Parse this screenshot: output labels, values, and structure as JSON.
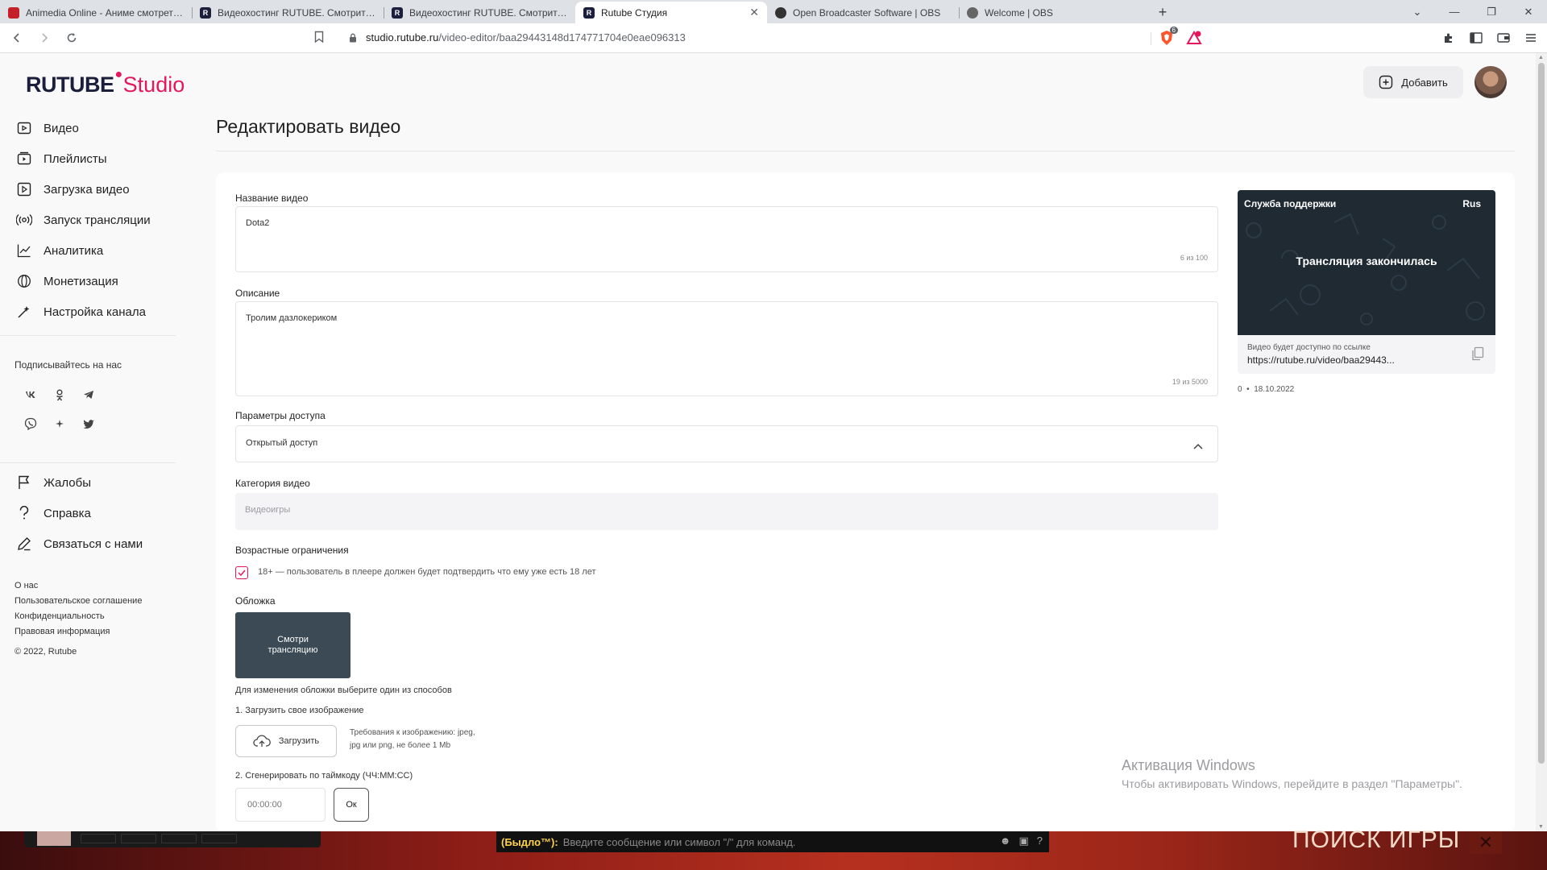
{
  "browser": {
    "tabs": [
      {
        "title": "Animedia Online - Аниме смотреть о",
        "fav_color": "#c3202a",
        "fav_glyph": ""
      },
      {
        "title": "Видеохостинг RUTUBE. Смотрите ви",
        "fav_color": "#1b1f3b",
        "fav_glyph": "R"
      },
      {
        "title": "Видеохостинг RUTUBE. Смотрите ви",
        "fav_color": "#1b1f3b",
        "fav_glyph": "R"
      },
      {
        "title": "Rutube Студия",
        "fav_color": "#1b1f3b",
        "fav_glyph": "R",
        "active": true
      },
      {
        "title": "Open Broadcaster Software | OBS",
        "fav_color": "#333333",
        "fav_glyph": ""
      },
      {
        "title": "Welcome | OBS",
        "fav_color": "#666666",
        "fav_glyph": ""
      }
    ],
    "url_host": "studio.rutube.ru",
    "url_path": "/video-editor/baa29443148d174771704e0eae096313",
    "brave_badge": "6"
  },
  "app": {
    "logo_main": "RUTUBE",
    "logo_studio": "Studio",
    "add_button": "Добавить",
    "accent": "#e4175b"
  },
  "sidebar": {
    "items": [
      {
        "label": "Видео",
        "icon": "video-icon"
      },
      {
        "label": "Плейлисты",
        "icon": "playlist-icon"
      },
      {
        "label": "Загрузка видео",
        "icon": "upload-video-icon"
      },
      {
        "label": "Запуск трансляции",
        "icon": "broadcast-icon"
      },
      {
        "label": "Аналитика",
        "icon": "analytics-icon"
      },
      {
        "label": "Монетизация",
        "icon": "monetization-icon"
      },
      {
        "label": "Настройка канала",
        "icon": "channel-settings-icon"
      }
    ],
    "follow_title": "Подписывайтесь на нас",
    "socials": [
      "vk-icon",
      "ok-icon",
      "telegram-icon",
      "viber-icon",
      "plus-icon",
      "twitter-icon"
    ],
    "support_items": [
      {
        "label": "Жалобы",
        "icon": "flag-icon"
      },
      {
        "label": "Справка",
        "icon": "help-icon"
      },
      {
        "label": "Связаться с нами",
        "icon": "contact-icon"
      }
    ],
    "footer_links": [
      "О нас",
      "Пользовательское соглашение",
      "Конфиденциальность",
      "Правовая информация"
    ],
    "copyright": "© 2022, Rutube"
  },
  "main": {
    "page_title": "Редактировать видео",
    "name_label": "Название видео",
    "name_value": "Dota2",
    "name_counter": "6 из 100",
    "desc_label": "Описание",
    "desc_value": "Тролим дазлокериком",
    "desc_counter": "19 из 5000",
    "access_label": "Параметры доступа",
    "access_value": "Открытый доступ",
    "category_label": "Категория видео",
    "category_value": "Видеоигры",
    "age_label": "Возрастные ограничения",
    "age_checkbox_text": "18+ — пользователь в плеере должен будет подтвердить что ему уже есть 18 лет",
    "age_checked": true,
    "cover_label": "Обложка",
    "cover_text": "Смотри трансляцию",
    "cover_hint": "Для изменения обложки выберите один из способов",
    "option1": "1. Загрузить свое изображение",
    "upload_button": "Загрузить",
    "requirements": "Требования к изображению: jpeg, jpg или png, не более 1 Mb",
    "option2": "2. Сгенерировать по таймкоду (ЧЧ:ММ:СС)",
    "timecode_placeholder": "00:00:00",
    "ok_button": "Ок"
  },
  "preview": {
    "support_title": "Служба поддержки",
    "lang": "Rus",
    "message": "Трансляция закончилась",
    "link_caption": "Видео будет доступно по ссылке",
    "link": "https://rutube.ru/video/baa29443...",
    "views": "0",
    "date": "18.10.2022"
  },
  "windows_activation": {
    "title": "Активация Windows",
    "subtitle": "Чтобы активировать Windows, перейдите в раздел \"Параметры\"."
  },
  "overlay": {
    "chat_user": "(Быдло™):",
    "chat_placeholder": "Введите сообщение или символ \"/\" для команд.",
    "search_game": "ПОИСК ИГРЫ",
    "close": "✕"
  }
}
